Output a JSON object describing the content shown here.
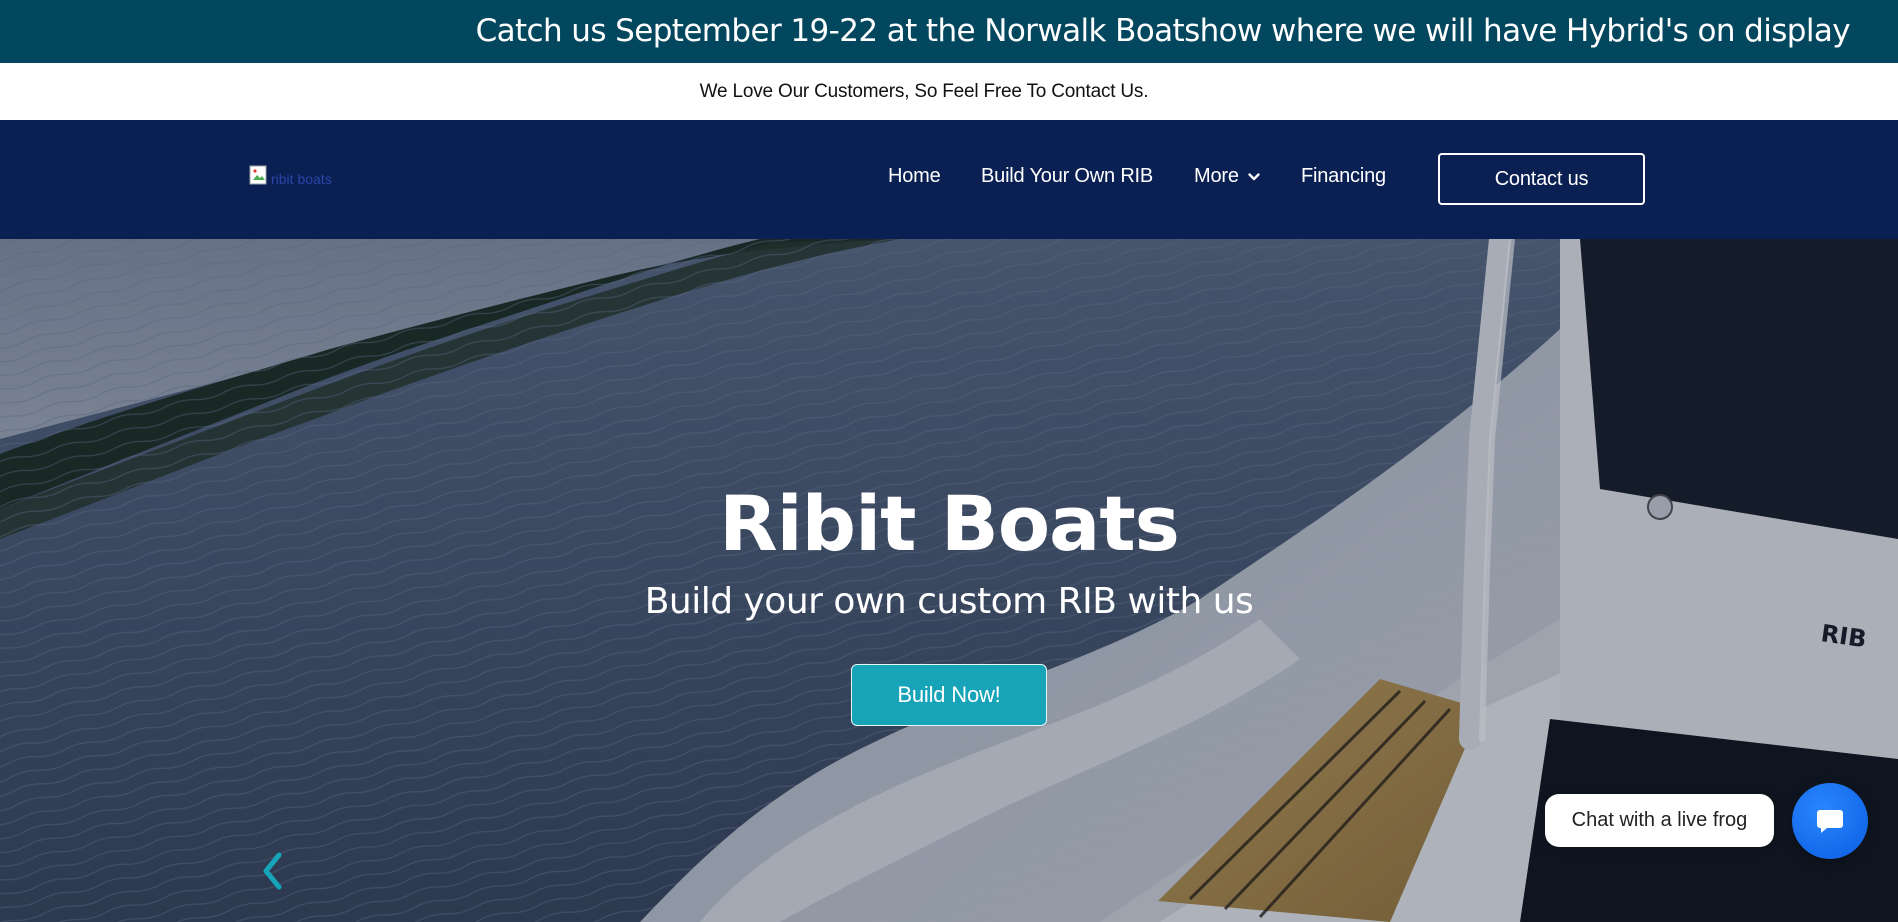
{
  "announcement": {
    "text": "Catch us September 19-22 at the Norwalk Boatshow where we will have Hybrid's on display"
  },
  "contact_strip": {
    "text": "We Love Our Customers, So Feel Free To Contact Us."
  },
  "header": {
    "logo_alt": "ribit boats",
    "nav": [
      {
        "label": "Home"
      },
      {
        "label": "Build Your Own RIB"
      },
      {
        "label": "More"
      },
      {
        "label": "Financing"
      }
    ],
    "contact_button": "Contact us"
  },
  "hero": {
    "title": "Ribit Boats",
    "subtitle": "Build your own custom RIB with us",
    "cta": "Build Now!",
    "hull_lettering": "RIB"
  },
  "chat": {
    "bubble_text": "Chat with a live frog"
  },
  "colors": {
    "announcement_bg": "#03475f",
    "header_bg": "#0b2052",
    "accent": "#17a3b8",
    "chat_blue": "#1a6ef5"
  },
  "icons": {
    "more_dropdown": "chevron-down-icon",
    "slider_prev": "chevron-left-icon",
    "chat": "chat-icon"
  }
}
